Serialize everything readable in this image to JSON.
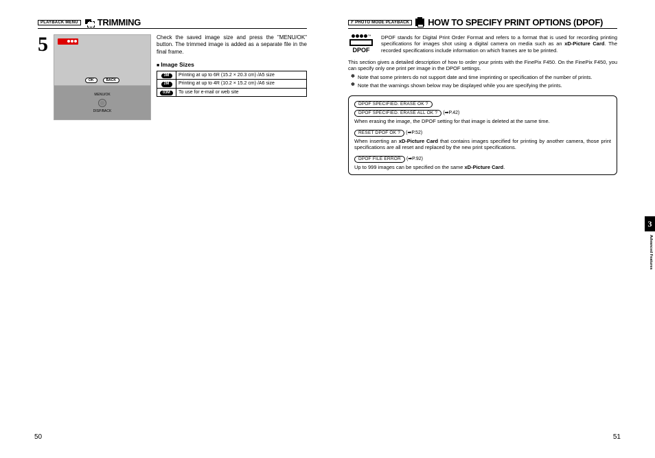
{
  "left": {
    "tag": "PLAYBACK MENU",
    "title": "TRIMMING",
    "step": "5",
    "body": "Check the saved image size and press the \"MENU/OK\" button. The trimmed image is added as a separate file in the final frame.",
    "sizes_header": "Image Sizes",
    "lcd_ok": "OK",
    "lcd_back": "BACK",
    "btn1": "MENU/OK",
    "btn2": "DISP/BACK",
    "table": [
      {
        "badge": "3M",
        "desc": "Printing at up to 6R (15.2 × 20.3 cm) /A5 size"
      },
      {
        "badge": "2M",
        "desc": "Printing at up to 4R (10.2 × 15.2 cm) /A6 size"
      },
      {
        "badge": "03M",
        "desc": "To use for e-mail or web site"
      }
    ],
    "pagenum": "50"
  },
  "right": {
    "tag_prefix": "F",
    "tag": " PHOTO MODE  PLAYBACK",
    "title": "HOW TO SPECIFY PRINT OPTIONS (DPOF)",
    "dpof_label": "DPOF",
    "para1_a": "DPOF stands for Digital Print Order Format and refers to a format that is used for recording printing specifications for images shot using a digital camera on media such as an ",
    "para1_b": "xD-Picture Card",
    "para1_c": ". The recorded specifications include information on which frames are to be printed.",
    "para2": "This section gives a detailed description of how to order your prints with the FinePix F450. On the FinePix F450, you can specify only one print per image in the DPOF settings.",
    "note1": "Note that some printers do not support date and time imprinting or specification of the number of prints.",
    "note2": "Note that the warnings shown below may be displayed while you are specifying the prints.",
    "box": {
      "m1": "DPOF SPECIFIED. ERASE OK ?",
      "m2": "DPOF SPECIFIED. ERASE ALL OK ?",
      "m2_ref": "(➡P.42)",
      "m2_text": "When erasing the image, the DPOF setting for that image is deleted at the same time.",
      "m3": "RESET DPOF OK ?",
      "m3_ref": "(➡P.52)",
      "m3_text_a": "When inserting an ",
      "m3_text_b": "xD-Picture Card",
      "m3_text_c": " that contains images specified for printing by another camera, those print specifications are all reset and replaced by the new print specifications.",
      "m4": "DPOF FILE ERROR",
      "m4_ref": "(➡P.92)",
      "m4_text_a": "Up to 999 images can be specified on the same ",
      "m4_text_b": "xD-Picture Card",
      "m4_text_c": "."
    },
    "tab_num": "3",
    "tab_label": "Advanced Features",
    "pagenum": "51"
  }
}
